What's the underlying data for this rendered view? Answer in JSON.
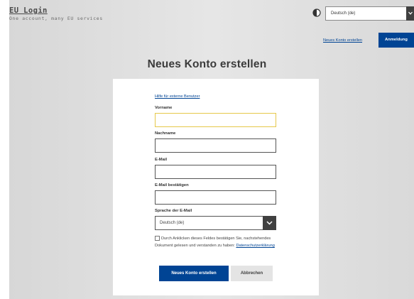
{
  "header": {
    "logo_title": "EU Login",
    "logo_subtitle": "One account, many EU services",
    "contrast_icon": "contrast-icon",
    "language_select": {
      "value": "Deutsch (de)"
    },
    "create_account_link": "Neues Konto erstellen",
    "login_button": "Anmeldung"
  },
  "page_title": "Neues Konto erstellen",
  "form": {
    "help_link": "Hilfe für externe Benutzer",
    "firstname": {
      "label": "Vorname",
      "value": ""
    },
    "lastname": {
      "label": "Nachname",
      "value": ""
    },
    "email": {
      "label": "E-Mail",
      "value": ""
    },
    "email_confirm": {
      "label": "E-Mail bestätigen",
      "value": ""
    },
    "email_language": {
      "label": "Sprache der E-Mail",
      "value": "Deutsch (de)"
    },
    "consent": {
      "checked": false,
      "text": "Durch Anklicken dieses Feldes bestätigen Sie, nachstehendes Dokument gelesen und verstanden zu haben:",
      "link": "Datenschutzerklärung"
    },
    "submit_button": "Neues Konto erstellen",
    "cancel_button": "Abbrechen"
  },
  "colors": {
    "primary": "#004494",
    "focus_border": "#e6c84a",
    "background": "#e0e0e0"
  }
}
